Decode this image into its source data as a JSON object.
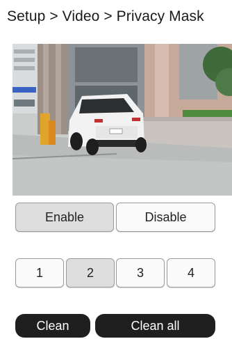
{
  "breadcrumb": {
    "text": "Setup > Video > Privacy Mask"
  },
  "preview": {
    "camera_image": "parking-garage-car-feed"
  },
  "mask_toggle": {
    "enable_label": "Enable",
    "disable_label": "Disable",
    "selected": "Enable"
  },
  "mask_numbers": {
    "items": [
      "1",
      "2",
      "3",
      "4"
    ],
    "selected": "2"
  },
  "actions": {
    "clean_label": "Clean",
    "clean_all_label": "Clean all"
  }
}
